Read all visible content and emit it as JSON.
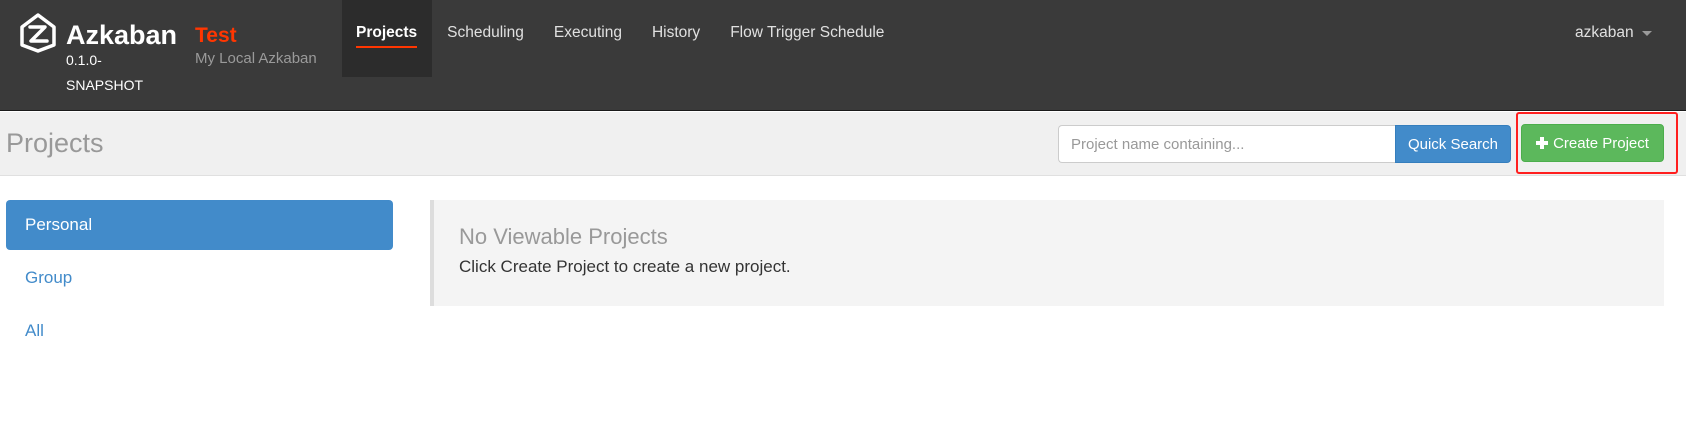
{
  "brand": {
    "name": "Azkaban",
    "version": "0.1.0-SNAPSHOT",
    "env_name": "Test",
    "env_description": "My Local Azkaban",
    "logo_icon": "azkaban-logo-icon"
  },
  "nav": {
    "items": [
      {
        "label": "Projects",
        "active": true
      },
      {
        "label": "Scheduling"
      },
      {
        "label": "Executing"
      },
      {
        "label": "History"
      },
      {
        "label": "Flow Trigger Schedule"
      }
    ],
    "user": "azkaban"
  },
  "header": {
    "title": "Projects",
    "search_placeholder": "Project name containing...",
    "search_button": "Quick Search",
    "create_button": "Create Project"
  },
  "sidebar": {
    "items": [
      {
        "label": "Personal",
        "active": true
      },
      {
        "label": "Group"
      },
      {
        "label": "All"
      }
    ]
  },
  "main": {
    "empty_title": "No Viewable Projects",
    "empty_text": "Click Create Project to create a new project."
  },
  "colors": {
    "navbar": "#3a3a3a",
    "accent": "#ff3601",
    "primary": "#428bca",
    "success": "#5cb85c",
    "highlight": "#ff1f1f"
  }
}
